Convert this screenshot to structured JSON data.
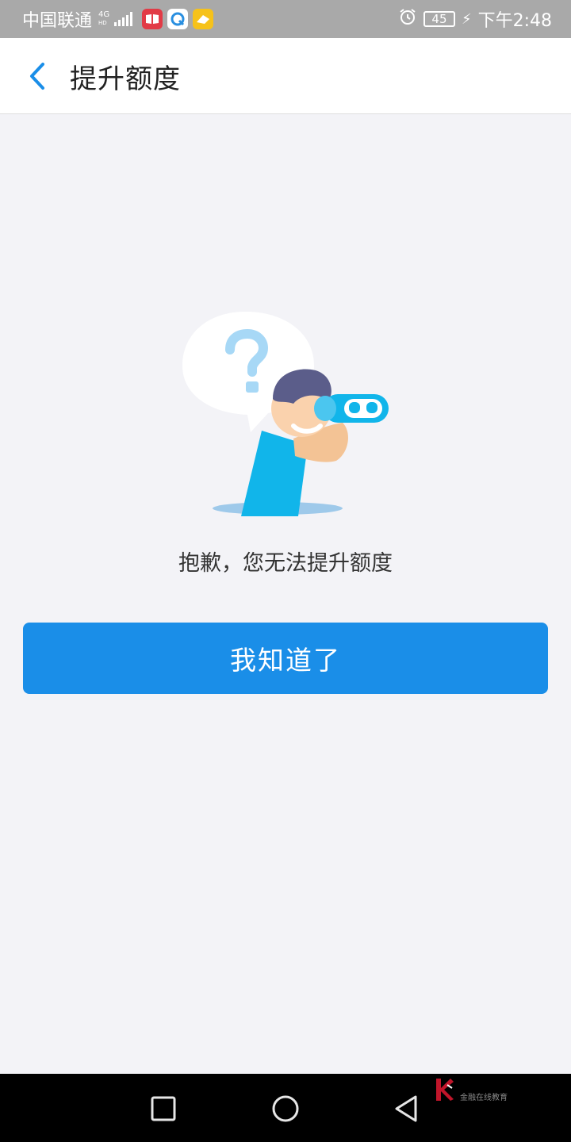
{
  "status_bar": {
    "carrier": "中国联通",
    "network_type": "4G",
    "network_sub": "HD",
    "battery": "45",
    "time": "下午2:48",
    "icons": [
      "signal-icon",
      "reader-app-icon",
      "browser-app-icon",
      "pay-app-icon",
      "alarm-icon",
      "battery-icon",
      "charging-icon"
    ]
  },
  "header": {
    "back_icon": "chevron-left-icon",
    "title": "提升额度"
  },
  "content": {
    "illustration": "person-with-binoculars-question-illustration",
    "message": "抱歉，您无法提升额度",
    "button_label": "我知道了"
  },
  "nav_bar": {
    "icons": [
      "recent-apps-icon",
      "home-icon",
      "back-icon"
    ],
    "watermark_text": "金融在线教育"
  },
  "colors": {
    "status_bar": "#a9a9a9",
    "accent": "#1a8ee8",
    "back_arrow": "#1a8ee8",
    "background": "#f3f3f7",
    "illustration_blue": "#11b5ea",
    "illustration_light": "#9fd6f5",
    "skin": "#f8c99c",
    "hair": "#5b5d8a"
  }
}
